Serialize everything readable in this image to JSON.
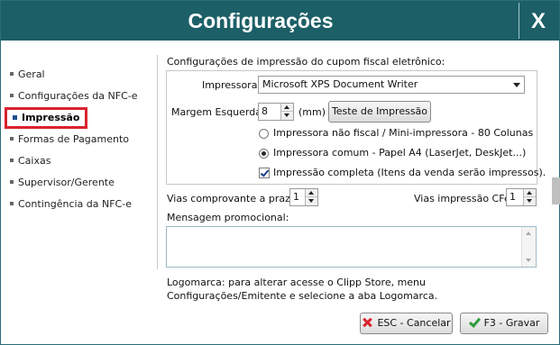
{
  "window": {
    "title": "Configurações",
    "close_label": "X"
  },
  "sidebar": {
    "items": [
      {
        "label": "Geral"
      },
      {
        "label": "Configurações da NFC-e"
      },
      {
        "label": "Impressão",
        "active": true
      },
      {
        "label": "Formas de Pagamento"
      },
      {
        "label": "Caixas"
      },
      {
        "label": "Supervisor/Gerente"
      },
      {
        "label": "Contingência da NFC-e"
      }
    ]
  },
  "main": {
    "section_title": "Configurações de impressão do cupom fiscal eletrônico:",
    "printer": {
      "label": "Impressora:",
      "value": "Microsoft XPS Document Writer"
    },
    "margin": {
      "label": "Margem Esquerda:",
      "value": "8",
      "unit": "(mm)"
    },
    "test_button": "Teste de Impressão",
    "printer_type_options": [
      {
        "label": "Impressora não fiscal / Mini-impressora - 80 Colunas",
        "checked": false
      },
      {
        "label": "Impressora comum - Papel A4 (LaserJet, DeskJet...)",
        "checked": true
      }
    ],
    "full_print": {
      "label": "Impressão completa (Itens da venda serão impressos).",
      "checked": true
    },
    "vias_prazo": {
      "label": "Vias comprovante a prazo:",
      "value": "1"
    },
    "vias_cfe": {
      "label": "Vias impressão CFe:",
      "value": "1"
    },
    "promo_message": {
      "label": "Mensagem promocional:",
      "value": ""
    },
    "logo_note": "Logomarca: para alterar acesse o Clipp Store, menu Configurações/Emitente e selecione a aba Logomarca."
  },
  "footer": {
    "cancel_label": "ESC - Cancelar",
    "save_label": "F3 - Gravar"
  },
  "colors": {
    "titlebar": "#1d5f67",
    "active_highlight": "#d9232d",
    "cancel_icon": "#d9232d",
    "save_icon": "#2e9b3a"
  }
}
